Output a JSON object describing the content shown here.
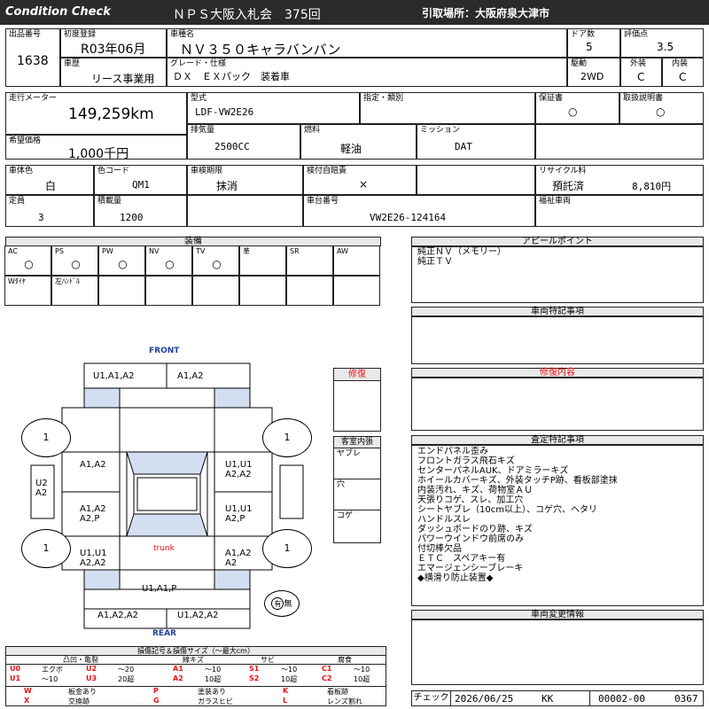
{
  "header": {
    "left": "Condition  Check",
    "title": "ＮＰＳ大阪入札会　375回",
    "pickup": "引取場所：大阪府泉大津市"
  },
  "vehicle": {
    "lot_label": "出品番号",
    "lot": "1638",
    "reg_label": "初度登録",
    "reg": "R03年06月",
    "name_label": "車種名",
    "name": "ＮＶ３５０キャラバンバン",
    "doors_label": "ドア数",
    "doors": "5",
    "score_label": "評価点",
    "score": "3.5",
    "history_label": "車歴",
    "history": "リース事業用",
    "grade_label": "グレード・仕様",
    "grade": "ＤＸ　ＥＸパック　装着車",
    "drive_label": "駆動",
    "drive": "2WD",
    "ext_label": "外装",
    "ext": "C",
    "int_label": "内装",
    "int": "C",
    "mileage_label": "走行メーター",
    "mileage": "149,259km",
    "model_label": "型式",
    "model": "LDF-VW2E26",
    "designation_label": "指定・類別",
    "warranty_label": "保証書",
    "warranty": "○",
    "manual_label": "取扱説明書",
    "manual": "○",
    "price_label": "希望価格",
    "price": "1,000千円",
    "displacement_label": "排気量",
    "displacement": "2500CC",
    "fuel_label": "燃料",
    "fuel": "軽油",
    "mission_label": "ミッション",
    "mission": "DAT",
    "color_label": "車体色",
    "color": "白",
    "color_code_label": "色コード",
    "color_code": "QM1",
    "inspection_label": "車検期限",
    "inspection": "抹消",
    "liability_label": "検付自賠責",
    "liability": "×",
    "recycle_label": "リサイクル料",
    "recycle_status": "預託済",
    "recycle_fee": "8,810円",
    "capacity_label": "定員",
    "capacity": "3",
    "load_label": "積載量",
    "load": "1200",
    "chassis_label": "車台番号",
    "chassis": "VW2E26-124164",
    "welfare_label": "福祉車両"
  },
  "equipment": {
    "title": "装備",
    "row1": [
      {
        "label": "AC",
        "mark": "○"
      },
      {
        "label": "PS",
        "mark": "○"
      },
      {
        "label": "PW",
        "mark": "○"
      },
      {
        "label": "NV",
        "mark": "○"
      },
      {
        "label": "TV",
        "mark": "○"
      },
      {
        "label": "革",
        "mark": ""
      },
      {
        "label": "SR",
        "mark": ""
      },
      {
        "label": "AW",
        "mark": ""
      }
    ],
    "row2": [
      {
        "label": "Wﾀｲﾔ"
      },
      {
        "label": "左ﾊﾝﾄﾞﾙ"
      },
      {
        "label": ""
      },
      {
        "label": ""
      },
      {
        "label": ""
      },
      {
        "label": ""
      },
      {
        "label": ""
      },
      {
        "label": ""
      }
    ]
  },
  "appeal": {
    "title": "アピールポイント",
    "lines": [
      "純正ＮＶ（メモリー）",
      "純正ＴＶ"
    ]
  },
  "special": {
    "title": "車両特記事項"
  },
  "repair_content": {
    "title": "修復内容"
  },
  "inspection_notes": {
    "title": "査定特記事項",
    "lines": [
      "エンドパネル歪み",
      "フロントガラス飛石キズ",
      "センターパネルAUK、ドアミラーキズ",
      "ホイールカバーキズ、外装タッチP跡、看板部塗抹",
      "内装汚れ、キズ、荷物室ＡＵ",
      "天張りコゲ、スレ、加工穴",
      "シートヤブレ（10cm以上）、コゲ穴、ヘタリ",
      "ハンドルスレ",
      "ダッシュボードのり跡、キズ",
      "パワーウインドウ前席のみ",
      "付切棒欠品",
      "ＥＴＣ　スペアキー有",
      "エマージェンシーブレーキ",
      "◆横滑り防止装置◆"
    ]
  },
  "change_info": {
    "title": "車両変更情報"
  },
  "check": {
    "label": "チェック",
    "date": "2026/06/25",
    "initials": "KK",
    "code1": "00002-00",
    "code2": "0367"
  },
  "diagram": {
    "front": "FRONT",
    "rear": "REAR",
    "trunk": "trunk",
    "tire_fl": "1",
    "tire_fr": "1",
    "tire_rl": "1",
    "tire_rr": "1",
    "roof_front_left": "U1,A1,A2",
    "roof_front_right": "A1,A2",
    "left_front": "A1,A2",
    "right_front": "U1,U1 A2,A2",
    "left_mid": "A1,A2 A2,P",
    "right_mid": "U1,U1 A2,P",
    "left_rear": "U1,U1 A2,A2",
    "right_rear": "A1,A2 A2",
    "left_side": "U2 A2",
    "rear_panel": "U1,A1,P",
    "bottom_left": "A1,A2,A2",
    "bottom_right": "U1,A2,A2",
    "badge_circle": "有",
    "badge_text": "無"
  },
  "repair": {
    "title": "修復"
  },
  "cabin": {
    "title": "客室内張",
    "items": [
      "ヤブレ",
      "穴",
      "コゲ"
    ]
  },
  "legend": {
    "title": "損傷記号＆損傷サイズ（～最大cm）",
    "groups": [
      "凸凹・亀裂",
      "線キズ",
      "サビ",
      "腐食"
    ],
    "rows": [
      [
        {
          "code": "U0",
          "desc": "エクボ"
        },
        {
          "code": "U2",
          "desc": "～20"
        },
        {
          "code": "A1",
          "desc": "～10"
        },
        {
          "code": "S1",
          "desc": "～10"
        },
        {
          "code": "C1",
          "desc": "～10"
        }
      ],
      [
        {
          "code": "U1",
          "desc": "～10"
        },
        {
          "code": "U3",
          "desc": "20超"
        },
        {
          "code": "A2",
          "desc": "10超"
        },
        {
          "code": "S2",
          "desc": "10超"
        },
        {
          "code": "C2",
          "desc": "10超"
        }
      ]
    ],
    "marks": [
      [
        {
          "code": "W",
          "desc": "板金あり"
        },
        {
          "code": "P",
          "desc": "塗装あり"
        },
        {
          "code": "K",
          "desc": "看板跡"
        }
      ],
      [
        {
          "code": "X",
          "desc": "交換跡"
        },
        {
          "code": "G",
          "desc": "ガラスヒビ"
        },
        {
          "code": "L",
          "desc": "レンズ割れ"
        }
      ]
    ]
  }
}
